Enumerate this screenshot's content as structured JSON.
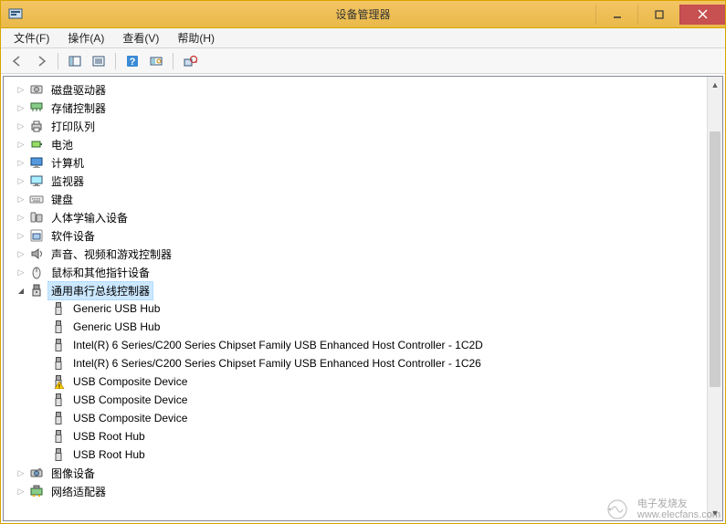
{
  "window": {
    "title": "设备管理器"
  },
  "menubar": {
    "items": [
      {
        "label": "文件(F)"
      },
      {
        "label": "操作(A)"
      },
      {
        "label": "查看(V)"
      },
      {
        "label": "帮助(H)"
      }
    ]
  },
  "tree": {
    "nodes": [
      {
        "level": 1,
        "expander": "closed",
        "icon": "disk-drive-icon",
        "label": "磁盘驱动器",
        "selected": false
      },
      {
        "level": 1,
        "expander": "closed",
        "icon": "storage-controller-icon",
        "label": "存储控制器",
        "selected": false
      },
      {
        "level": 1,
        "expander": "closed",
        "icon": "printer-icon",
        "label": "打印队列",
        "selected": false
      },
      {
        "level": 1,
        "expander": "closed",
        "icon": "battery-icon",
        "label": "电池",
        "selected": false
      },
      {
        "level": 1,
        "expander": "closed",
        "icon": "computer-icon",
        "label": "计算机",
        "selected": false
      },
      {
        "level": 1,
        "expander": "closed",
        "icon": "monitor-icon",
        "label": "监视器",
        "selected": false
      },
      {
        "level": 1,
        "expander": "closed",
        "icon": "keyboard-icon",
        "label": "键盘",
        "selected": false
      },
      {
        "level": 1,
        "expander": "closed",
        "icon": "hid-icon",
        "label": "人体学输入设备",
        "selected": false
      },
      {
        "level": 1,
        "expander": "closed",
        "icon": "software-device-icon",
        "label": "软件设备",
        "selected": false
      },
      {
        "level": 1,
        "expander": "closed",
        "icon": "audio-icon",
        "label": "声音、视频和游戏控制器",
        "selected": false
      },
      {
        "level": 1,
        "expander": "closed",
        "icon": "mouse-icon",
        "label": "鼠标和其他指针设备",
        "selected": false
      },
      {
        "level": 1,
        "expander": "open",
        "icon": "usb-controller-icon",
        "label": "通用串行总线控制器",
        "selected": true
      },
      {
        "level": 2,
        "expander": "none",
        "icon": "usb-hub-icon",
        "label": "Generic USB Hub",
        "selected": false
      },
      {
        "level": 2,
        "expander": "none",
        "icon": "usb-hub-icon",
        "label": "Generic USB Hub",
        "selected": false
      },
      {
        "level": 2,
        "expander": "none",
        "icon": "usb-hub-icon",
        "label": "Intel(R) 6 Series/C200 Series Chipset Family USB Enhanced Host Controller - 1C2D",
        "selected": false
      },
      {
        "level": 2,
        "expander": "none",
        "icon": "usb-hub-icon",
        "label": "Intel(R) 6 Series/C200 Series Chipset Family USB Enhanced Host Controller - 1C26",
        "selected": false
      },
      {
        "level": 2,
        "expander": "none",
        "icon": "usb-device-warning-icon",
        "label": "USB Composite Device",
        "selected": false
      },
      {
        "level": 2,
        "expander": "none",
        "icon": "usb-device-icon",
        "label": "USB Composite Device",
        "selected": false
      },
      {
        "level": 2,
        "expander": "none",
        "icon": "usb-device-icon",
        "label": "USB Composite Device",
        "selected": false
      },
      {
        "level": 2,
        "expander": "none",
        "icon": "usb-hub-icon",
        "label": "USB Root Hub",
        "selected": false
      },
      {
        "level": 2,
        "expander": "none",
        "icon": "usb-hub-icon",
        "label": "USB Root Hub",
        "selected": false
      },
      {
        "level": 1,
        "expander": "closed",
        "icon": "imaging-icon",
        "label": "图像设备",
        "selected": false
      },
      {
        "level": 1,
        "expander": "closed",
        "icon": "network-adapter-icon",
        "label": "网络适配器",
        "selected": false
      }
    ]
  },
  "watermark": {
    "line1": "电子发烧友",
    "line2": "www.elecfans.com"
  }
}
